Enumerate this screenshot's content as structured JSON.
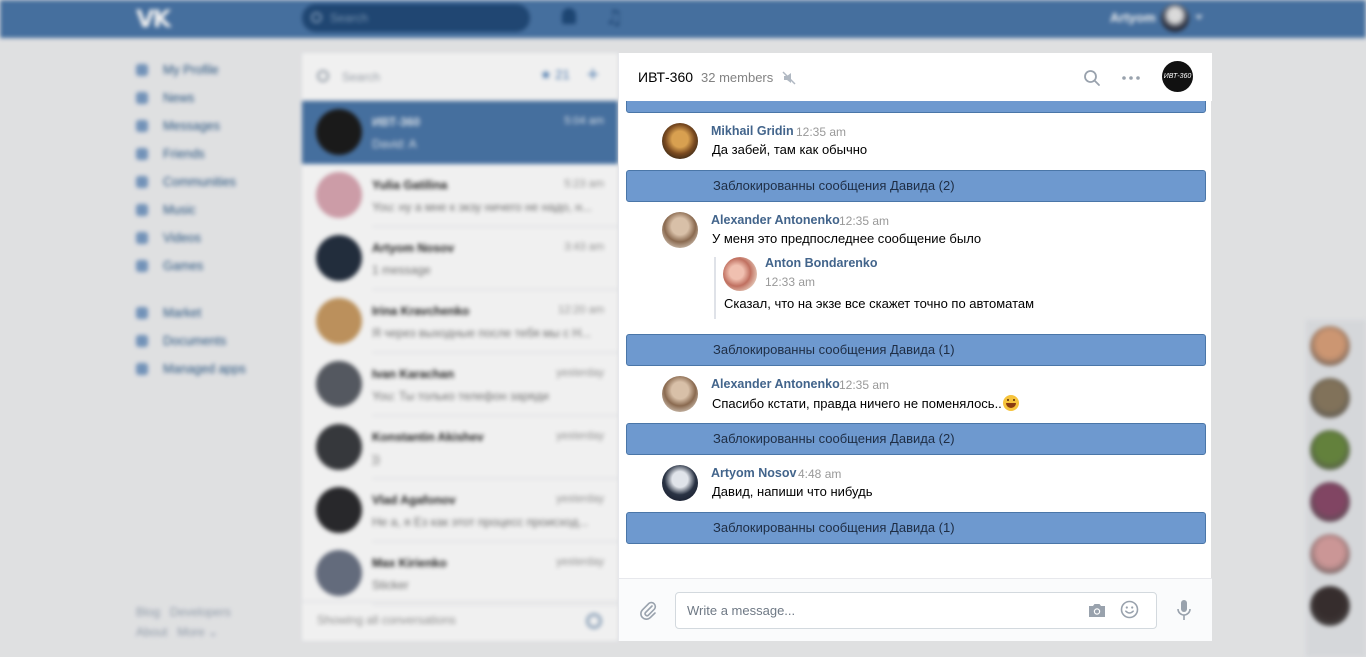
{
  "topbar": {
    "logo": "VK",
    "search_placeholder": "Search",
    "user_name": "Artyom"
  },
  "leftnav": {
    "items": [
      "My Profile",
      "News",
      "Messages",
      "Friends",
      "Communities",
      "Music",
      "Videos",
      "Games"
    ],
    "items2": [
      "Market",
      "Documents",
      "Managed apps"
    ],
    "footer": [
      "Blog",
      "Developers",
      "About",
      "More ⌄"
    ]
  },
  "convlist": {
    "search_placeholder": "Search",
    "unread_count": "21",
    "items": [
      {
        "name": "ИВТ-360",
        "time": "5:04 am",
        "preview": "David: A",
        "color": "#1c1c1c"
      },
      {
        "name": "Yulia Gatilina",
        "time": "5:23 am",
        "preview": "You: ну а мне к экзу ничего не надо, н...",
        "color": "#d9a6b2"
      },
      {
        "name": "Artyom Nosov",
        "time": "3:43 am",
        "preview": "1 message",
        "color": "#253040"
      },
      {
        "name": "Irina Kravchenko",
        "time": "12:20 am",
        "preview": "Я через выходные после тебя мы с Н...",
        "color": "#c79a62"
      },
      {
        "name": "Ivan Karachan",
        "time": "yesterday",
        "preview": "You: Ты только телефон заряди",
        "color": "#5a5e66"
      },
      {
        "name": "Konstantin Akishev",
        "time": "yesterday",
        "preview": "))",
        "color": "#3a3c40"
      },
      {
        "name": "Vlad Agafonov",
        "time": "yesterday",
        "preview": "Не а, я Ез как этот процесс происход...",
        "color": "#2b2b2e"
      },
      {
        "name": "Max Kirienko",
        "time": "yesterday",
        "preview": "Sticker",
        "color": "#6a7284"
      }
    ],
    "footer": "Showing all conversations"
  },
  "rightbar": {
    "avatar_colors": [
      "#d9a07a",
      "#8a7a60",
      "#6a8a40",
      "#8a4a6a",
      "#d8a0a0",
      "#3a3030"
    ]
  },
  "chat": {
    "title": "ИВТ-360",
    "members": "32 members",
    "avatar_text": "ИВТ-360",
    "blocked": [
      "Заблокированны сообщения Давида (2)",
      "Заблокированны сообщения Давида (1)",
      "Заблокированны сообщения Давида (2)",
      "Заблокированны сообщения Давида (1)"
    ],
    "messages": [
      {
        "name": "Mikhail Gridin",
        "time": "12:35 am",
        "text": "Да забей, там как обычно"
      },
      {
        "name": "Alexander Antonenko",
        "time": "12:35 am",
        "text": "У меня это предпоследнее сообщение было"
      },
      {
        "name": "Alexander Antonenko",
        "time": "12:35 am",
        "text": "Спасибо кстати, правда ничего не поменялось.."
      },
      {
        "name": "Artyom Nosov",
        "time": "4:48 am",
        "text": "Давид, напиши что нибудь"
      }
    ],
    "quote": {
      "name": "Anton Bondarenko",
      "time": "12:33 am",
      "text": "Сказал, что на экзе все скажет точно по автоматам"
    },
    "composer_placeholder": "Write a message..."
  }
}
